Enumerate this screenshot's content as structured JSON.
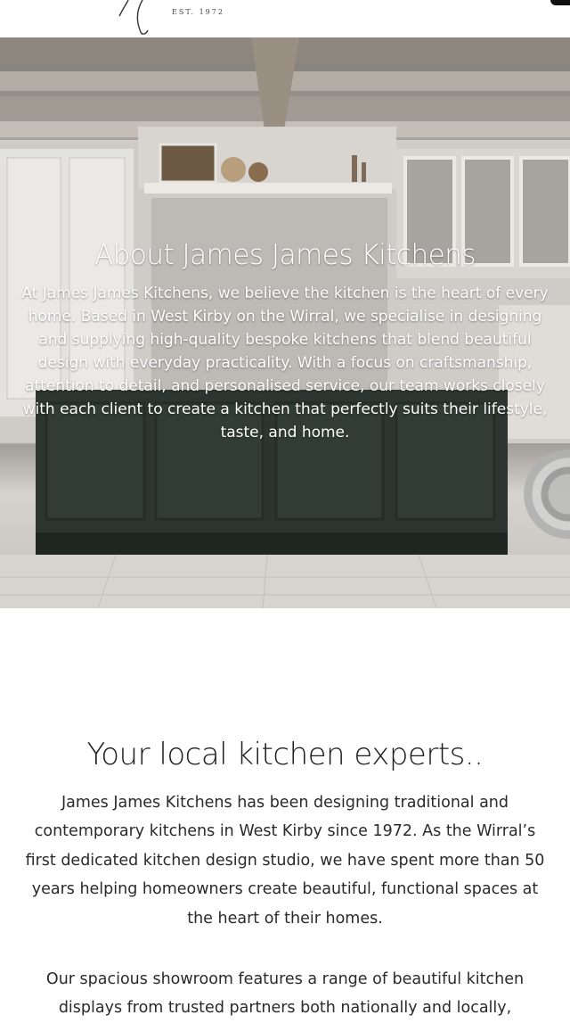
{
  "header": {
    "est": "EST. 1972"
  },
  "hero": {
    "title": "About James James Kitchens",
    "body": "At James James Kitchens, we believe the kitchen is the heart of every home. Based in West Kirby on the Wirral, we specialise in designing and supplying high-quality bespoke kitchens that blend beautiful design with everyday practicality. With a focus on craftsmanship, attention to detail, and personalised service, our team works closely with each client to create a kitchen that perfectly suits their lifestyle, taste, and home."
  },
  "section": {
    "title": "Your local kitchen experts..",
    "paragraph1": "James James Kitchens has been designing traditional and contemporary kitchens in West Kirby since 1972. As the Wirral’s first dedicated kitchen design studio, we have spent more than 50 years helping homeowners create beautiful, functional spaces at the heart of their homes.",
    "paragraph2": "Our spacious showroom features a range of beautiful kitchen displays from trusted partners both nationally and locally,"
  },
  "icons": {
    "logo": "logo-monogram-icon",
    "menu": "menu-icon",
    "scroll": "scroll-dial-icon"
  },
  "colors": {
    "island": "#2c3530",
    "text": "#2a2a2a",
    "hero_text": "#ffffff"
  }
}
